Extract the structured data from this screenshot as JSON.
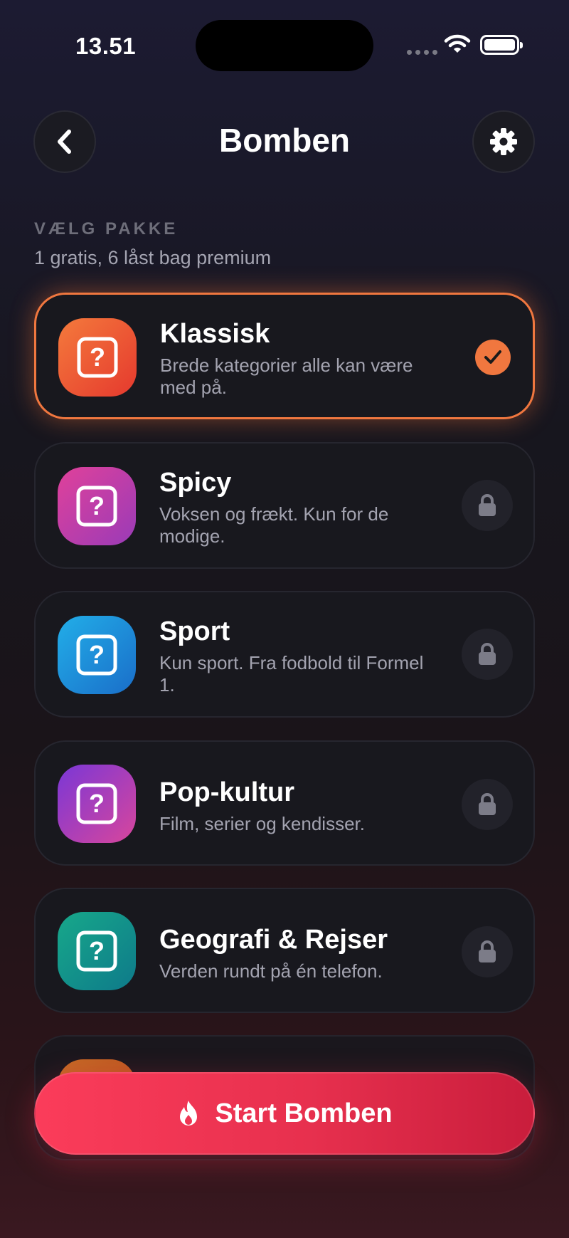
{
  "status_bar": {
    "time": "13.51"
  },
  "header": {
    "title": "Bomben",
    "back_icon": "chevron-left-icon",
    "settings_icon": "gear-icon"
  },
  "section": {
    "label": "VÆLG PAKKE",
    "subtitle": "1 gratis, 6 låst bag premium"
  },
  "packs": [
    {
      "name": "Klassisk",
      "description": "Brede kategorier alle kan være med på.",
      "selected": true,
      "locked": false,
      "icon": "question-icon",
      "colors": [
        "#f47a3c",
        "#e5392e"
      ]
    },
    {
      "name": "Spicy",
      "description": "Voksen og frækt. Kun for de modige.",
      "selected": false,
      "locked": true,
      "icon": "question-icon",
      "colors": [
        "#e0419a",
        "#9a3bb8"
      ]
    },
    {
      "name": "Sport",
      "description": "Kun sport. Fra fodbold til Formel 1.",
      "selected": false,
      "locked": true,
      "icon": "question-icon",
      "colors": [
        "#22aee8",
        "#1a6ec9"
      ]
    },
    {
      "name": "Pop-kultur",
      "description": "Film, serier og kendisser.",
      "selected": false,
      "locked": true,
      "icon": "question-icon",
      "colors": [
        "#7a37d6",
        "#d8469c"
      ]
    },
    {
      "name": "Geografi & Rejser",
      "description": "Verden rundt på én telefon.",
      "selected": false,
      "locked": true,
      "icon": "question-icon",
      "colors": [
        "#17a88a",
        "#0e7a8a"
      ]
    }
  ],
  "start_button": {
    "label": "Start Bomben",
    "icon": "flame-icon"
  },
  "colors": {
    "accent": "#f0773f",
    "start": "#f03a55"
  }
}
